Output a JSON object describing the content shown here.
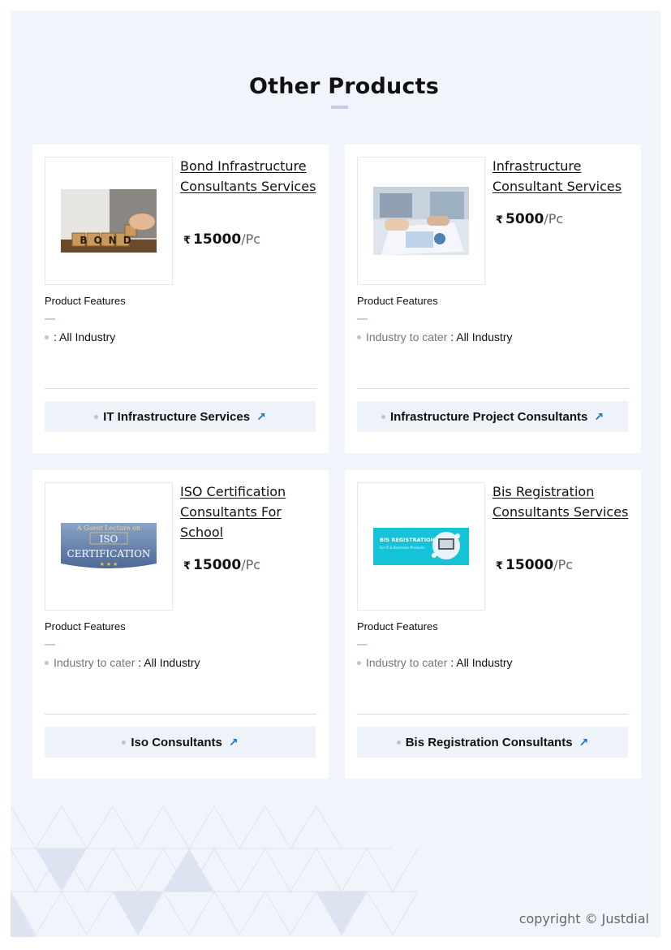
{
  "section": {
    "title": "Other Products"
  },
  "products": [
    {
      "name": "Bond Infrastructure Consultants Services",
      "currency": "₹",
      "price": "15000",
      "unit": "/Pc",
      "features_label": "Product Features",
      "feature_key": "",
      "feature_sep": ":",
      "feature_value": "All Industry",
      "category": "IT Infrastructure Services",
      "image_text": "BOND"
    },
    {
      "name": "Infrastructure Consultant Services",
      "currency": "₹",
      "price": "5000",
      "unit": "/Pc",
      "features_label": "Product Features",
      "feature_key": "Industry to cater",
      "feature_sep": ":",
      "feature_value": "All Industry",
      "category": "Infrastructure Project Consultants"
    },
    {
      "name": "ISO Certification Consultants For School",
      "currency": "₹",
      "price": "15000",
      "unit": "/Pc",
      "features_label": "Product Features",
      "feature_key": "Industry to cater",
      "feature_sep": ":",
      "feature_value": "All Industry",
      "category": "Iso Consultants",
      "image_text_top": "A Guest Lecture on",
      "image_text_main1": "ISO",
      "image_text_main2": "CERTIFICATION"
    },
    {
      "name": "Bis Registration Consultants Services",
      "currency": "₹",
      "price": "15000",
      "unit": "/Pc",
      "features_label": "Product Features",
      "feature_key": "Industry to cater",
      "feature_sep": ":",
      "feature_value": "All Industry",
      "category": "Bis Registration Consultants",
      "image_text": "BIS REGISTRATION",
      "image_subtext": "For IT & Electronic Products"
    }
  ],
  "footer": {
    "copyright": "copyright © Justdial"
  },
  "icons": {
    "category_link": "arrow-up-right-icon"
  },
  "colors": {
    "accent": "#1a6fc6",
    "page_bg": "#f1f5fb",
    "button_bg": "#eef2f9"
  }
}
